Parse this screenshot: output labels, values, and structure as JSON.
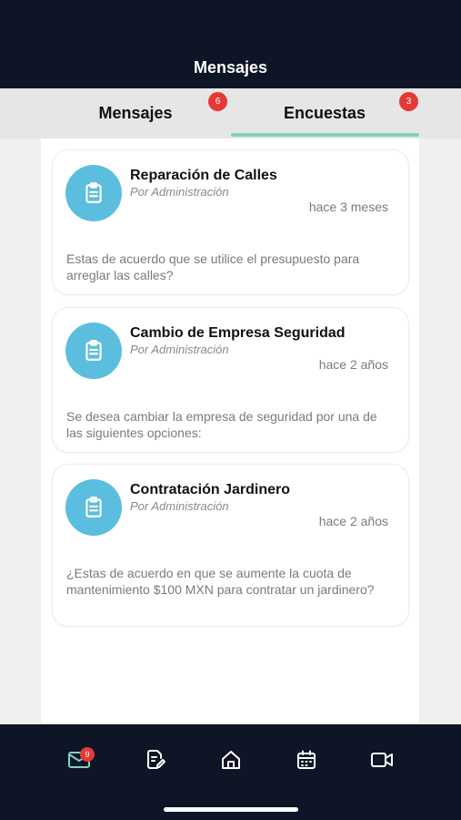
{
  "header": {
    "title": "Mensajes"
  },
  "tabs": [
    {
      "label": "Mensajes",
      "badge": "6",
      "active": false
    },
    {
      "label": "Encuestas",
      "badge": "3",
      "active": true
    }
  ],
  "surveys": [
    {
      "title": "Reparación de Calles",
      "author": "Por Administración",
      "time": "hace 3 meses",
      "description": "Estas de acuerdo que se utilice el presupuesto para arreglar las calles?",
      "icon": "clipboard-icon"
    },
    {
      "title": "Cambio de Empresa Seguridad",
      "author": "Por Administración",
      "time": "hace 2 años",
      "description": "Se desea cambiar la empresa de seguridad por una de las siguientes opciones:",
      "icon": "clipboard-icon"
    },
    {
      "title": "Contratación Jardinero",
      "author": "Por Administración",
      "time": "hace 2 años",
      "description": "¿Estas de acuerdo en que se aumente la cuota de mantenimiento $100 MXN para contratar un jardinero?",
      "icon": "clipboard-icon"
    }
  ],
  "bottom_nav": {
    "items": [
      "mail-icon",
      "edit-document-icon",
      "home-icon",
      "calendar-icon",
      "video-camera-icon"
    ],
    "mail_badge": "9",
    "active_color": "#7fd3bd",
    "icon_color": "#ffffff"
  },
  "colors": {
    "header_bg": "#0d1526",
    "accent": "#7fd3bd",
    "avatar": "#5cbede",
    "badge": "#e53935"
  }
}
